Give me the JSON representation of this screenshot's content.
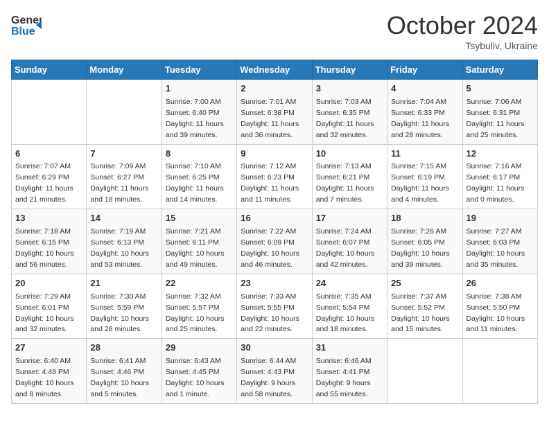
{
  "header": {
    "logo_line1": "General",
    "logo_line2": "Blue",
    "month": "October 2024",
    "location": "Tsybuliv, Ukraine"
  },
  "weekdays": [
    "Sunday",
    "Monday",
    "Tuesday",
    "Wednesday",
    "Thursday",
    "Friday",
    "Saturday"
  ],
  "weeks": [
    [
      {
        "day": "",
        "info": ""
      },
      {
        "day": "",
        "info": ""
      },
      {
        "day": "1",
        "info": "Sunrise: 7:00 AM\nSunset: 6:40 PM\nDaylight: 11 hours and 39 minutes."
      },
      {
        "day": "2",
        "info": "Sunrise: 7:01 AM\nSunset: 6:38 PM\nDaylight: 11 hours and 36 minutes."
      },
      {
        "day": "3",
        "info": "Sunrise: 7:03 AM\nSunset: 6:35 PM\nDaylight: 11 hours and 32 minutes."
      },
      {
        "day": "4",
        "info": "Sunrise: 7:04 AM\nSunset: 6:33 PM\nDaylight: 11 hours and 28 minutes."
      },
      {
        "day": "5",
        "info": "Sunrise: 7:06 AM\nSunset: 6:31 PM\nDaylight: 11 hours and 25 minutes."
      }
    ],
    [
      {
        "day": "6",
        "info": "Sunrise: 7:07 AM\nSunset: 6:29 PM\nDaylight: 11 hours and 21 minutes."
      },
      {
        "day": "7",
        "info": "Sunrise: 7:09 AM\nSunset: 6:27 PM\nDaylight: 11 hours and 18 minutes."
      },
      {
        "day": "8",
        "info": "Sunrise: 7:10 AM\nSunset: 6:25 PM\nDaylight: 11 hours and 14 minutes."
      },
      {
        "day": "9",
        "info": "Sunrise: 7:12 AM\nSunset: 6:23 PM\nDaylight: 11 hours and 11 minutes."
      },
      {
        "day": "10",
        "info": "Sunrise: 7:13 AM\nSunset: 6:21 PM\nDaylight: 11 hours and 7 minutes."
      },
      {
        "day": "11",
        "info": "Sunrise: 7:15 AM\nSunset: 6:19 PM\nDaylight: 11 hours and 4 minutes."
      },
      {
        "day": "12",
        "info": "Sunrise: 7:16 AM\nSunset: 6:17 PM\nDaylight: 11 hours and 0 minutes."
      }
    ],
    [
      {
        "day": "13",
        "info": "Sunrise: 7:18 AM\nSunset: 6:15 PM\nDaylight: 10 hours and 56 minutes."
      },
      {
        "day": "14",
        "info": "Sunrise: 7:19 AM\nSunset: 6:13 PM\nDaylight: 10 hours and 53 minutes."
      },
      {
        "day": "15",
        "info": "Sunrise: 7:21 AM\nSunset: 6:11 PM\nDaylight: 10 hours and 49 minutes."
      },
      {
        "day": "16",
        "info": "Sunrise: 7:22 AM\nSunset: 6:09 PM\nDaylight: 10 hours and 46 minutes."
      },
      {
        "day": "17",
        "info": "Sunrise: 7:24 AM\nSunset: 6:07 PM\nDaylight: 10 hours and 42 minutes."
      },
      {
        "day": "18",
        "info": "Sunrise: 7:26 AM\nSunset: 6:05 PM\nDaylight: 10 hours and 39 minutes."
      },
      {
        "day": "19",
        "info": "Sunrise: 7:27 AM\nSunset: 6:03 PM\nDaylight: 10 hours and 35 minutes."
      }
    ],
    [
      {
        "day": "20",
        "info": "Sunrise: 7:29 AM\nSunset: 6:01 PM\nDaylight: 10 hours and 32 minutes."
      },
      {
        "day": "21",
        "info": "Sunrise: 7:30 AM\nSunset: 5:59 PM\nDaylight: 10 hours and 28 minutes."
      },
      {
        "day": "22",
        "info": "Sunrise: 7:32 AM\nSunset: 5:57 PM\nDaylight: 10 hours and 25 minutes."
      },
      {
        "day": "23",
        "info": "Sunrise: 7:33 AM\nSunset: 5:55 PM\nDaylight: 10 hours and 22 minutes."
      },
      {
        "day": "24",
        "info": "Sunrise: 7:35 AM\nSunset: 5:54 PM\nDaylight: 10 hours and 18 minutes."
      },
      {
        "day": "25",
        "info": "Sunrise: 7:37 AM\nSunset: 5:52 PM\nDaylight: 10 hours and 15 minutes."
      },
      {
        "day": "26",
        "info": "Sunrise: 7:38 AM\nSunset: 5:50 PM\nDaylight: 10 hours and 11 minutes."
      }
    ],
    [
      {
        "day": "27",
        "info": "Sunrise: 6:40 AM\nSunset: 4:48 PM\nDaylight: 10 hours and 8 minutes."
      },
      {
        "day": "28",
        "info": "Sunrise: 6:41 AM\nSunset: 4:46 PM\nDaylight: 10 hours and 5 minutes."
      },
      {
        "day": "29",
        "info": "Sunrise: 6:43 AM\nSunset: 4:45 PM\nDaylight: 10 hours and 1 minute."
      },
      {
        "day": "30",
        "info": "Sunrise: 6:44 AM\nSunset: 4:43 PM\nDaylight: 9 hours and 58 minutes."
      },
      {
        "day": "31",
        "info": "Sunrise: 6:46 AM\nSunset: 4:41 PM\nDaylight: 9 hours and 55 minutes."
      },
      {
        "day": "",
        "info": ""
      },
      {
        "day": "",
        "info": ""
      }
    ]
  ]
}
